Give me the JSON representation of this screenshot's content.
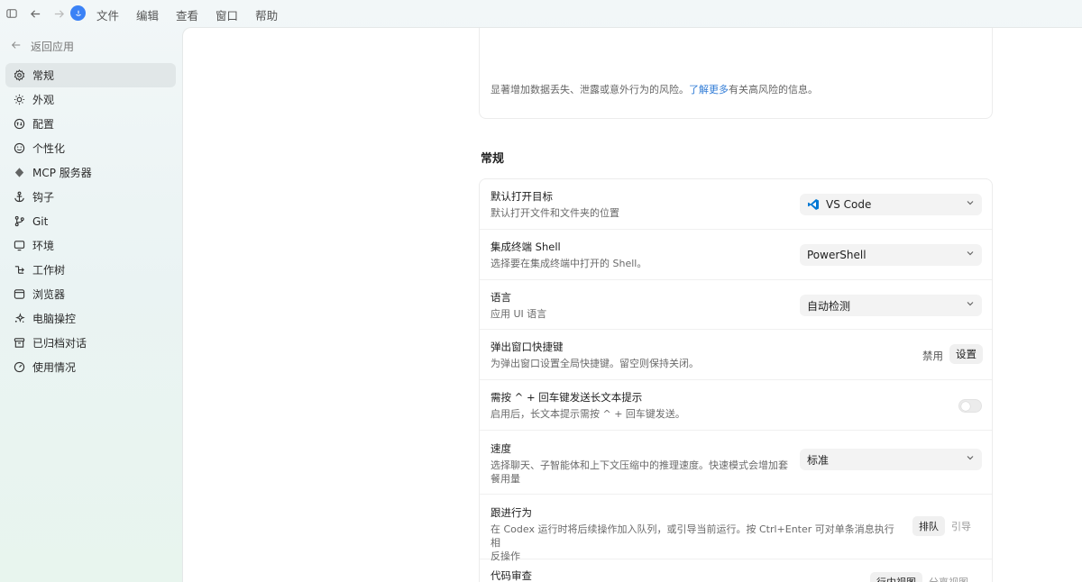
{
  "titlebar": {
    "menu": [
      "文件",
      "编辑",
      "查看",
      "窗口",
      "帮助"
    ]
  },
  "sidebar": {
    "back_label": "返回应用",
    "items": [
      {
        "label": "常规",
        "icon": "gear-icon"
      },
      {
        "label": "外观",
        "icon": "sun-icon"
      },
      {
        "label": "配置",
        "icon": "sliders-icon"
      },
      {
        "label": "个性化",
        "icon": "smile-icon"
      },
      {
        "label": "MCP 服务器",
        "icon": "mcp-icon"
      },
      {
        "label": "钩子",
        "icon": "anchor-icon"
      },
      {
        "label": "Git",
        "icon": "git-branch-icon"
      },
      {
        "label": "环境",
        "icon": "monitor-icon"
      },
      {
        "label": "工作树",
        "icon": "worktree-icon"
      },
      {
        "label": "浏览器",
        "icon": "browser-icon"
      },
      {
        "label": "电脑操控",
        "icon": "sparkle-icon"
      },
      {
        "label": "已归档对话",
        "icon": "archive-icon"
      },
      {
        "label": "使用情况",
        "icon": "gauge-icon"
      }
    ]
  },
  "warning": {
    "text_before": "显著增加数据丢失、泄露或意外行为的风险。",
    "link": "了解更多",
    "text_after": "有关高风险的信息。"
  },
  "section_title": "常规",
  "settings": {
    "default_open": {
      "label": "默认打开目标",
      "desc": "默认打开文件和文件夹的位置",
      "value": "VS Code"
    },
    "shell": {
      "label": "集成终端 Shell",
      "desc": "选择要在集成终端中打开的 Shell。",
      "value": "PowerShell"
    },
    "language": {
      "label": "语言",
      "desc": "应用 UI 语言",
      "value": "自动检测"
    },
    "popup_shortcut": {
      "label": "弹出窗口快捷键",
      "desc": "为弹出窗口设置全局快捷键。留空则保持关闭。",
      "disable_label": "禁用",
      "set_label": "设置"
    },
    "long_prompt": {
      "label": "需按 ^ + 回车键发送长文本提示",
      "desc": "启用后，长文本提示需按 ^ + 回车键发送。",
      "enabled": false
    },
    "speed": {
      "label": "速度",
      "desc_line1": "选择聊天、子智能体和上下文压缩中的推理速度。快速模式会增加套",
      "desc_line2": "餐用量",
      "value": "标准"
    },
    "follow_up": {
      "label": "跟进行为",
      "desc_line1": "在 Codex 运行时将后续操作加入队列，或引导当前运行。按 Ctrl+Enter 可对单条消息执行相",
      "desc_line2": "反操作",
      "option_queue": "排队",
      "option_steer": "引导"
    },
    "code_review": {
      "label": "代码审查",
      "option_inline": "行内视图",
      "option_split": "分离视图"
    }
  },
  "colors": {
    "accent": "#2f7bd6",
    "logo": "#3b82f6",
    "vscode": "#0078d4"
  }
}
